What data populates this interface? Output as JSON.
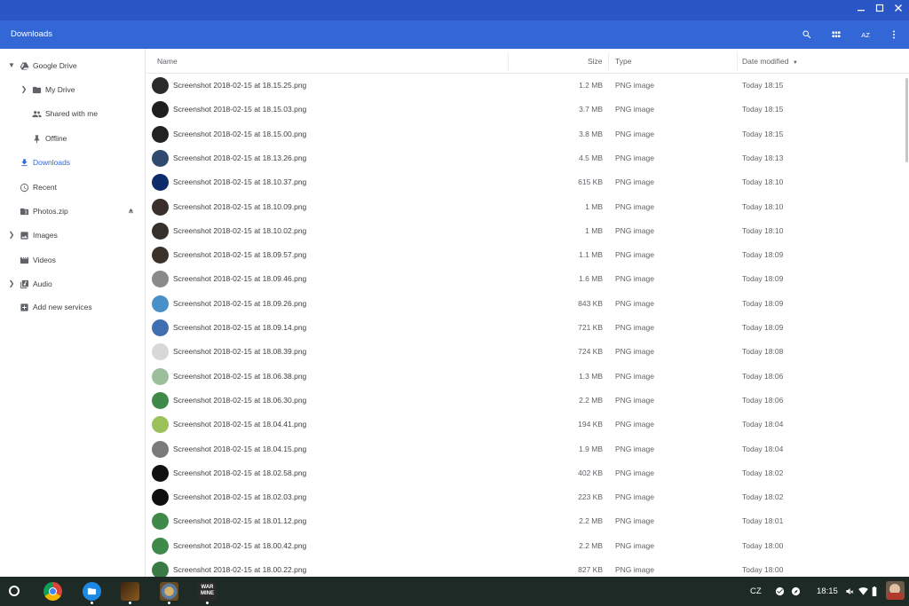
{
  "window": {
    "title": "Downloads",
    "controls": [
      "minimize-icon",
      "maximize-icon",
      "close-icon"
    ]
  },
  "toolbar": {
    "title": "Downloads",
    "buttons": [
      "search-icon",
      "grid-view-icon",
      "sort-az-icon",
      "more-vert-icon"
    ],
    "sort_label": "AZ"
  },
  "sidebar": {
    "items": [
      {
        "label": "Google Drive",
        "icon": "drive-icon",
        "expander": "chevron-down-icon"
      },
      {
        "label": "My Drive",
        "icon": "folder-drive-icon",
        "expander": "chevron-right-icon"
      },
      {
        "label": "Shared with me",
        "icon": "people-icon"
      },
      {
        "label": "Offline",
        "icon": "pin-icon"
      },
      {
        "label": "Downloads",
        "icon": "download-icon",
        "active": true
      },
      {
        "label": "Recent",
        "icon": "clock-icon"
      },
      {
        "label": "Photos.zip",
        "icon": "zip-icon",
        "trailing": "eject-icon"
      },
      {
        "label": "Images",
        "icon": "image-icon",
        "expander": "chevron-right-icon"
      },
      {
        "label": "Videos",
        "icon": "video-icon"
      },
      {
        "label": "Audio",
        "icon": "audio-icon",
        "expander": "chevron-right-icon"
      },
      {
        "label": "Add new services",
        "icon": "add-box-icon"
      }
    ]
  },
  "table": {
    "headers": {
      "name": "Name",
      "size": "Size",
      "type": "Type",
      "date": "Date modified"
    },
    "sort_indicator": "sort-desc-icon",
    "rows": [
      {
        "name": "Screenshot 2018-02-15 at 18.15.25.png",
        "size": "1.2 MB",
        "type": "PNG image",
        "date": "Today 18:15",
        "thumb": "#2b2b2b"
      },
      {
        "name": "Screenshot 2018-02-15 at 18.15.03.png",
        "size": "3.7 MB",
        "type": "PNG image",
        "date": "Today 18:15",
        "thumb": "#1e1e1e"
      },
      {
        "name": "Screenshot 2018-02-15 at 18.15.00.png",
        "size": "3.8 MB",
        "type": "PNG image",
        "date": "Today 18:15",
        "thumb": "#222222"
      },
      {
        "name": "Screenshot 2018-02-15 at 18.13.26.png",
        "size": "4.5 MB",
        "type": "PNG image",
        "date": "Today 18:13",
        "thumb": "#2f4a6e"
      },
      {
        "name": "Screenshot 2018-02-15 at 18.10.37.png",
        "size": "615 KB",
        "type": "PNG image",
        "date": "Today 18:10",
        "thumb": "#0d2a6b"
      },
      {
        "name": "Screenshot 2018-02-15 at 18.10.09.png",
        "size": "1 MB",
        "type": "PNG image",
        "date": "Today 18:10",
        "thumb": "#3a2f2a"
      },
      {
        "name": "Screenshot 2018-02-15 at 18.10.02.png",
        "size": "1 MB",
        "type": "PNG image",
        "date": "Today 18:10",
        "thumb": "#35302c"
      },
      {
        "name": "Screenshot 2018-02-15 at 18.09.57.png",
        "size": "1.1 MB",
        "type": "PNG image",
        "date": "Today 18:09",
        "thumb": "#3b322c"
      },
      {
        "name": "Screenshot 2018-02-15 at 18.09.46.png",
        "size": "1.6 MB",
        "type": "PNG image",
        "date": "Today 18:09",
        "thumb": "#8a8a8a"
      },
      {
        "name": "Screenshot 2018-02-15 at 18.09.26.png",
        "size": "843 KB",
        "type": "PNG image",
        "date": "Today 18:09",
        "thumb": "#4a90c8"
      },
      {
        "name": "Screenshot 2018-02-15 at 18.09.14.png",
        "size": "721 KB",
        "type": "PNG image",
        "date": "Today 18:09",
        "thumb": "#3f6fb0"
      },
      {
        "name": "Screenshot 2018-02-15 at 18.08.39.png",
        "size": "724 KB",
        "type": "PNG image",
        "date": "Today 18:08",
        "thumb": "#d8d8d8"
      },
      {
        "name": "Screenshot 2018-02-15 at 18.06.38.png",
        "size": "1.3 MB",
        "type": "PNG image",
        "date": "Today 18:06",
        "thumb": "#9bbf9b"
      },
      {
        "name": "Screenshot 2018-02-15 at 18.06.30.png",
        "size": "2.2 MB",
        "type": "PNG image",
        "date": "Today 18:06",
        "thumb": "#3f8a4a"
      },
      {
        "name": "Screenshot 2018-02-15 at 18.04.41.png",
        "size": "194 KB",
        "type": "PNG image",
        "date": "Today 18:04",
        "thumb": "#9cc05a"
      },
      {
        "name": "Screenshot 2018-02-15 at 18.04.15.png",
        "size": "1.9 MB",
        "type": "PNG image",
        "date": "Today 18:04",
        "thumb": "#7a7a7a"
      },
      {
        "name": "Screenshot 2018-02-15 at 18.02.58.png",
        "size": "402 KB",
        "type": "PNG image",
        "date": "Today 18:02",
        "thumb": "#111111"
      },
      {
        "name": "Screenshot 2018-02-15 at 18.02.03.png",
        "size": "223 KB",
        "type": "PNG image",
        "date": "Today 18:02",
        "thumb": "#0f0f0f"
      },
      {
        "name": "Screenshot 2018-02-15 at 18.01.12.png",
        "size": "2.2 MB",
        "type": "PNG image",
        "date": "Today 18:01",
        "thumb": "#3f8a4a"
      },
      {
        "name": "Screenshot 2018-02-15 at 18.00.42.png",
        "size": "2.2 MB",
        "type": "PNG image",
        "date": "Today 18:00",
        "thumb": "#3f8a4a"
      },
      {
        "name": "Screenshot 2018-02-15 at 18.00.22.png",
        "size": "827 KB",
        "type": "PNG image",
        "date": "Today 18:00",
        "thumb": "#3a7a44"
      }
    ]
  },
  "shelf": {
    "apps": [
      {
        "icon": "chrome-icon",
        "color": "#db4437"
      },
      {
        "icon": "files-icon",
        "color": "#1e88e5"
      },
      {
        "icon": "game-app-icon",
        "color": "#5a3a1a"
      },
      {
        "icon": "hearthstone-app-icon",
        "color": "#7a5a2a"
      },
      {
        "icon": "this-war-of-mine-app-icon",
        "color": "#333333"
      }
    ],
    "tray": {
      "ime": "CZ",
      "time": "18:15"
    }
  },
  "colors": {
    "titlebar": "#2a56c6",
    "toolbar": "#3367d6",
    "accent": "#3367d6",
    "shelf": "#1d2a25"
  }
}
